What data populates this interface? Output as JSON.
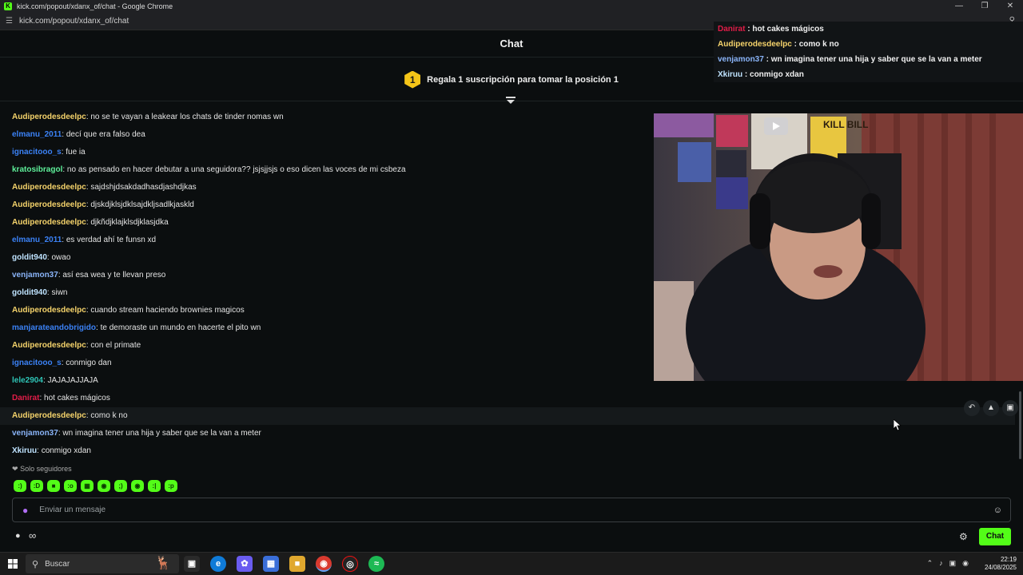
{
  "window": {
    "title": "kick.com/popout/xdanx_of/chat - Google Chrome",
    "url": "kick.com/popout/xdanx_of/chat",
    "favicon_letter": "K"
  },
  "chat": {
    "header_title": "Chat",
    "gift_rank": "1",
    "gift_text": "Regala 1 suscripción para tomar la posición 1",
    "followers_only": "Solo seguidores",
    "input_placeholder": "Enviar un mensaje",
    "send_button": "Chat"
  },
  "colors": {
    "accent": "#53fc18",
    "user_yellow": "#f5d36b",
    "user_blue": "#3b82f6",
    "user_lightblue": "#8ab4f8",
    "user_green": "#5ef09a",
    "user_red": "#e11d48",
    "user_teal": "#2ec4b6",
    "user_white": "#bfe3ff"
  },
  "messages": [
    {
      "user": "Audiperodesdeelpc",
      "color": "#f5d36b",
      "text": "no se te vayan a leakear los chats de tinder nomas wn"
    },
    {
      "user": "elmanu_2011",
      "color": "#3b82f6",
      "text": "decí que era falso dea"
    },
    {
      "user": "ignacitooo_s",
      "color": "#3b82f6",
      "text": "fue ia"
    },
    {
      "user": "kratosibragol",
      "color": "#5ef09a",
      "text": "no as pensado en hacer debutar a una seguidora?? jsjsjjsjs o eso dicen las voces de mi csbeza"
    },
    {
      "user": "Audiperodesdeelpc",
      "color": "#f5d36b",
      "text": "sajdshjdsakdadhasdjashdjkas"
    },
    {
      "user": "Audiperodesdeelpc",
      "color": "#f5d36b",
      "text": "djskdjklsjdklsajdkljsadlkjaskld"
    },
    {
      "user": "Audiperodesdeelpc",
      "color": "#f5d36b",
      "text": "djkñdjklajklsdjklasjdka"
    },
    {
      "user": "elmanu_2011",
      "color": "#3b82f6",
      "text": "es verdad ahí te funsn xd"
    },
    {
      "user": "goldit940",
      "color": "#bfe3ff",
      "text": "owao"
    },
    {
      "user": "venjamon37",
      "color": "#8ab4f8",
      "text": "así esa wea y te llevan preso"
    },
    {
      "user": "goldit940",
      "color": "#bfe3ff",
      "text": "siwn"
    },
    {
      "user": "Audiperodesdeelpc",
      "color": "#f5d36b",
      "text": "cuando stream haciendo brownies magicos"
    },
    {
      "user": "manjarateandobrigido",
      "color": "#3b82f6",
      "text": "te demoraste un mundo en hacerte el pito wn"
    },
    {
      "user": "Audiperodesdeelpc",
      "color": "#f5d36b",
      "text": "con el primate"
    },
    {
      "user": "ignacitooo_s",
      "color": "#3b82f6",
      "text": "conmigo dan"
    },
    {
      "user": "lele2904",
      "color": "#2ec4b6",
      "text": "JAJAJAJJAJA"
    },
    {
      "user": "Danirat",
      "color": "#e11d48",
      "text": "hot cakes mágicos"
    },
    {
      "user": "Audiperodesdeelpc",
      "color": "#f5d36b",
      "text": "como k no",
      "highlight": true
    },
    {
      "user": "venjamon37",
      "color": "#8ab4f8",
      "text": "wn imagina tener una hija y saber que se la van a meter"
    },
    {
      "user": "Xkiruu",
      "color": "#bfe3ff",
      "text": "conmigo xdan"
    }
  ],
  "overlay_messages": [
    {
      "user": "Danirat",
      "color": "#e11d48",
      "text": "hot cakes mágicos"
    },
    {
      "user": "Audiperodesdeelpc",
      "color": "#f5d36b",
      "text": "como k no"
    },
    {
      "user": "venjamon37",
      "color": "#8ab4f8",
      "text": "wn imagina tener una hija y saber que se la van a meter"
    },
    {
      "user": "Xkiruu",
      "color": "#bfe3ff",
      "text": "conmigo xdan"
    }
  ],
  "webcam_poster": "KILL BILL",
  "taskbar": {
    "search_placeholder": "Buscar",
    "time": "22:19",
    "date": "24/08/2025"
  }
}
